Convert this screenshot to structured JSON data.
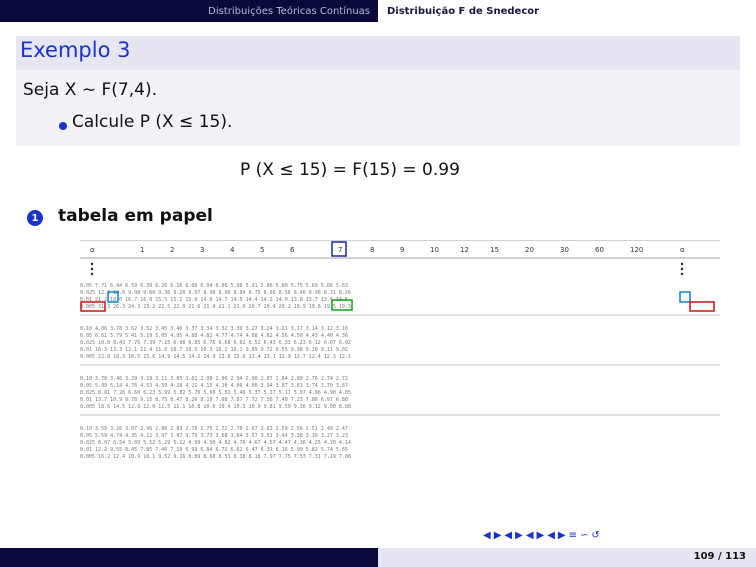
{
  "header": {
    "section_left": "Distribuições Teóricas Contínuas",
    "section_right": "Distribuição F de Snedecor"
  },
  "slide": {
    "title": "Exemplo 3",
    "line1": "Seja X ∼ F(7,4).",
    "bullet": "Calcule P (X ≤ 15).",
    "equation": "P (X ≤ 15) = F(15) = 0.99",
    "enum_number": "1",
    "enum_text": "tabela em papel"
  },
  "table_colors": {
    "red": "#cc0000",
    "blue": "#0077cc",
    "green": "#00a000",
    "navy": "#1a2a9a"
  },
  "nav": {
    "symbols": [
      "◀",
      "▶",
      "◀",
      "▶",
      "◀",
      "▶",
      "◀",
      "▶",
      "≡",
      "∽",
      "↺"
    ]
  },
  "footer": {
    "page": "109 / 113"
  }
}
